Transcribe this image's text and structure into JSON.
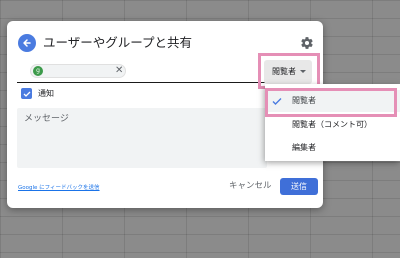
{
  "dialog": {
    "title": "ユーザーやグループと共有",
    "chip_initial": "g",
    "notify_label": "通知",
    "message_placeholder": "メッセージ",
    "feedback_link": "Google にフィードバックを送信",
    "cancel_label": "キャンセル",
    "send_label": "送信"
  },
  "role_selector": {
    "current_label": "閲覧者",
    "options": [
      {
        "label": "閲覧者",
        "selected": true
      },
      {
        "label": "閲覧者（コメント可）",
        "selected": false
      },
      {
        "label": "編集者",
        "selected": false
      }
    ]
  },
  "colors": {
    "accent": "#4a7be0",
    "send_button": "#3f6fd8",
    "highlight_outline": "#e58fb6",
    "chip_avatar": "#3c9a4a"
  },
  "icons": [
    "back-arrow-icon",
    "gear-icon",
    "close-icon",
    "checkbox-checked-icon",
    "dropdown-caret-icon",
    "check-icon"
  ]
}
